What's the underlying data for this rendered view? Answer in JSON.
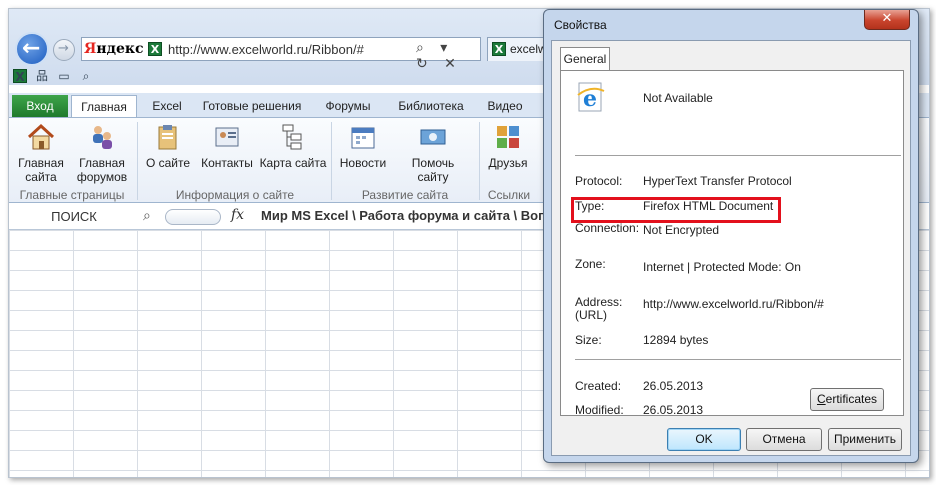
{
  "browser": {
    "logo": "Яндекс",
    "logo_first_letter": "Я",
    "logo_rest": "ндекс",
    "url": "http://www.excelworld.ru/Ribbon/#",
    "tab_title": "excelw",
    "address_icons": "⌕ ▾ ↻ ✕"
  },
  "ribbon": {
    "tabs": [
      {
        "label": "Вход"
      },
      {
        "label": "Главная"
      },
      {
        "label": "Excel"
      },
      {
        "label": "Готовые решения"
      },
      {
        "label": "Форумы"
      },
      {
        "label": "Библиотека"
      },
      {
        "label": "Видео"
      }
    ],
    "groups": [
      {
        "label": "Главные страницы",
        "buttons": [
          {
            "line1": "Главная",
            "line2": "сайта"
          },
          {
            "line1": "Главная",
            "line2": "форумов"
          }
        ]
      },
      {
        "label": "Информация о сайте",
        "buttons": [
          {
            "line1": "О сайте"
          },
          {
            "line1": "Контакты"
          },
          {
            "line1": "Карта сайта"
          }
        ]
      },
      {
        "label": "Развитие сайта",
        "buttons": [
          {
            "line1": "Новости"
          },
          {
            "line1": "Помочь сайту"
          }
        ]
      },
      {
        "label": "Ссылки",
        "buttons": [
          {
            "line1": "Друзья"
          }
        ]
      }
    ]
  },
  "formula_bar": {
    "name_box": "ПОИСК",
    "fx": "fx",
    "text": "Мир MS Excel \\ Работа форума и сайта \\ Вопр"
  },
  "dialog": {
    "title": "Свойства",
    "close": "✕",
    "tab": "General",
    "name": "Not Available",
    "properties": {
      "protocol_label": "Protocol:",
      "protocol_value": "HyperText Transfer Protocol",
      "type_label": "Type:",
      "type_value": "Firefox HTML Document",
      "connection_label": "Connection:",
      "connection_value": "Not Encrypted",
      "zone_label": "Zone:",
      "zone_value": "Internet | Protected Mode: On",
      "address_label_1": "Address:",
      "address_label_2": "(URL)",
      "address_value": "http://www.excelworld.ru/Ribbon/#",
      "size_label": "Size:",
      "size_value": "12894 bytes",
      "created_label": "Created:",
      "created_value": "26.05.2013",
      "modified_label": "Modified:",
      "modified_value": "26.05.2013"
    },
    "certificates_button": {
      "accel": "C",
      "rest": "ertificates"
    },
    "ok_button": "OK",
    "cancel_button": "Отмена",
    "apply_button": "Применить"
  },
  "colors": {
    "highlight_border": "#e3101c",
    "file_tab": "#2a8b35",
    "dialog_frame": "#c5d6ec"
  }
}
